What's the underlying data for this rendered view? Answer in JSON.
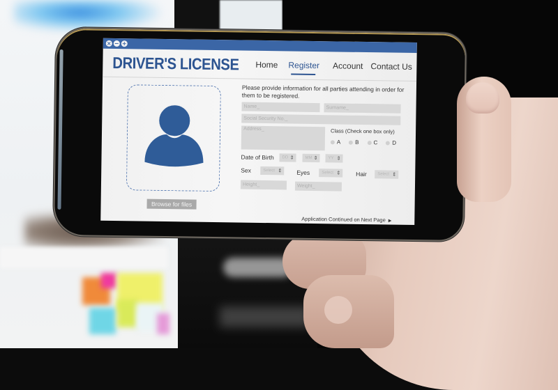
{
  "app": {
    "window_controls": [
      "close",
      "minimize",
      "maximize"
    ],
    "brand_title": "DRIVER'S LICENSE",
    "accent_color": "#2d5491",
    "titlebar_color": "#3b66a6"
  },
  "nav": {
    "items": [
      {
        "label": "Home",
        "active": false
      },
      {
        "label": "Register",
        "active": true
      },
      {
        "label": "Account",
        "active": false
      },
      {
        "label": "Contact Us",
        "active": false
      }
    ]
  },
  "photo_upload": {
    "icon": "user-silhouette-icon",
    "browse_label": "Browse for files"
  },
  "form": {
    "instructions": "Please provide information for all parties attending in order for them to be registered.",
    "name_placeholder": "Name_",
    "surname_placeholder": "Surname_",
    "ssn_placeholder": "Social Security No._",
    "address_placeholder": "Address_",
    "class_label": "Class (Check one box only)",
    "class_options": [
      "A",
      "B",
      "C",
      "D"
    ],
    "dob_label": "Date of Birth",
    "dob_day": "DD",
    "dob_month": "MM",
    "dob_year": "YY",
    "sex_label": "Sex",
    "sex_value": "Select",
    "eyes_label": "Eyes",
    "eyes_value": "Select",
    "hair_label": "Hair",
    "hair_value": "Select",
    "height_placeholder": "Height_",
    "weight_placeholder": "Weight_",
    "continue_text": "Application Continued on Next Page"
  }
}
